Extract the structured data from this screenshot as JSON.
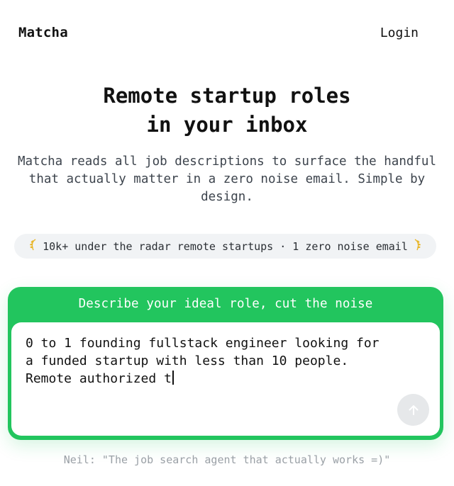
{
  "nav": {
    "brand": "Matcha",
    "login_label": "Login"
  },
  "hero": {
    "title_line1": "Remote startup roles",
    "title_line2": "in your inbox",
    "subtitle": "Matcha reads all job descriptions to surface the handful that actually matter in a zero noise email. Simple by design."
  },
  "badge": {
    "text": "10k+ under the radar remote startups · 1 zero noise email",
    "icon": "laurel-icon",
    "accent_color": "#e8b62a"
  },
  "card": {
    "title": "Describe your ideal role, cut the noise",
    "background_color": "#22c55e",
    "input_value": "0 to 1 founding fullstack engineer looking for a funded startup with less than 10 people. Remote authorized t",
    "send_icon": "arrow-up-icon"
  },
  "testimonial": {
    "text": "Neil: \"The job search agent that actually works =)\""
  }
}
